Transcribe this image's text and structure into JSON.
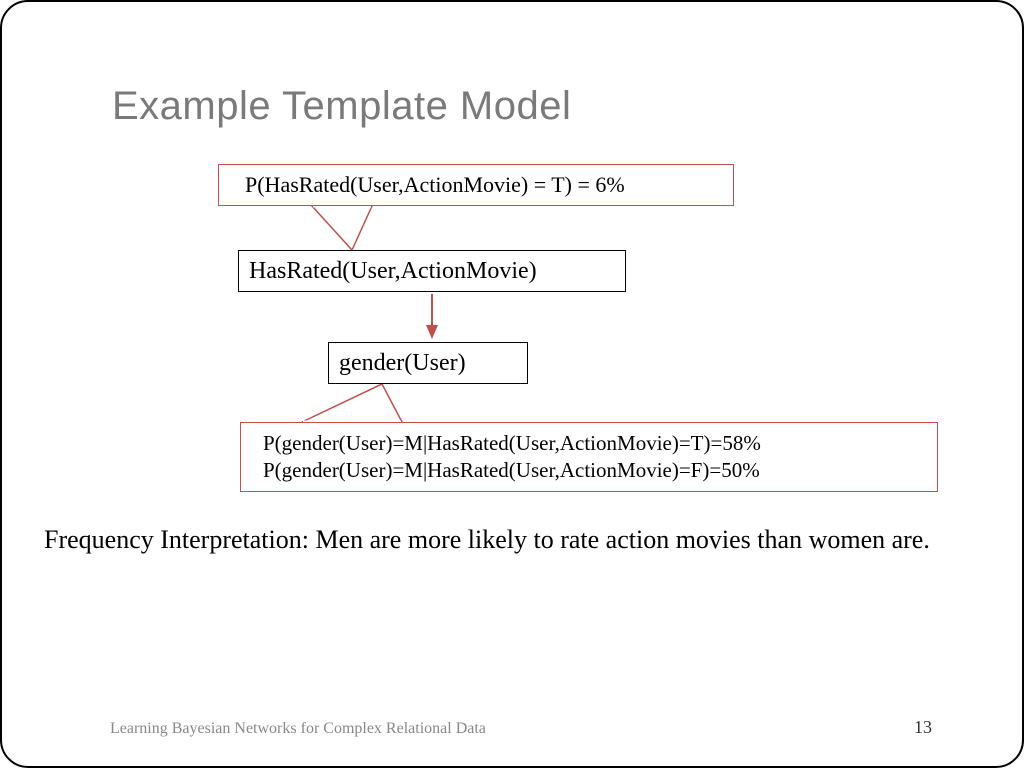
{
  "title": "Example Template Model",
  "callout_top": "P(HasRated(User,ActionMovie) = T) = 6%",
  "node_top": "HasRated(User,ActionMovie)",
  "node_bot": "gender(User)",
  "callout_bot_line1": "P(gender(User)=M|HasRated(User,ActionMovie)=T)=58%",
  "callout_bot_line2": "P(gender(User)=M|HasRated(User,ActionMovie)=F)=50%",
  "interpretation": "Frequency Interpretation: Men are more likely to rate action movies than women are.",
  "footer": "Learning Bayesian Networks for Complex Relational Data",
  "page": "13"
}
